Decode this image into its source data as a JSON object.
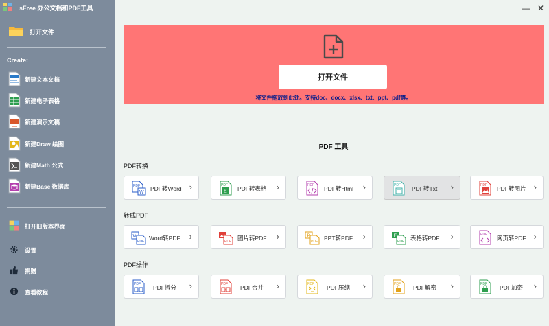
{
  "app": {
    "title": "sFree 办公文档和PDF工具"
  },
  "window": {
    "minimize": "—",
    "close": "✕"
  },
  "sidebar": {
    "open_file": "打开文件",
    "create_label": "Create:",
    "create_items": [
      {
        "label": "新建文本文档",
        "color": "#2a7ac8"
      },
      {
        "label": "新建电子表格",
        "color": "#2e9e4f"
      },
      {
        "label": "新建演示文稿",
        "color": "#d9572b"
      },
      {
        "label": "新建Draw 绘图",
        "color": "#e3b71a"
      },
      {
        "label": "新建Math 公式",
        "color": "#555555"
      },
      {
        "label": "新建Base 数据库",
        "color": "#b33fae"
      }
    ],
    "legacy": "打开旧版本界面",
    "settings": "设置",
    "donate": "捐赠",
    "tutorial": "查看教程"
  },
  "dropzone": {
    "button": "打开文件",
    "hint": "将文件拖放到此处。支持doc、docx、xlsx、txt、ppt、pdf等。",
    "color": "#ff7575"
  },
  "tools": {
    "title": "PDF 工具",
    "sections": [
      {
        "label": "PDF转换",
        "items": [
          {
            "label": "PDF转Word",
            "icon": "pdf-to-word-icon",
            "color": "#2a5cc8"
          },
          {
            "label": "PDF转表格",
            "icon": "pdf-to-excel-icon",
            "color": "#2e9e4f"
          },
          {
            "label": "PDF转Html",
            "icon": "pdf-to-html-icon",
            "color": "#b33fae"
          },
          {
            "label": "PDF转Txt",
            "icon": "pdf-to-txt-icon",
            "color": "#3fb0a8",
            "active": true
          },
          {
            "label": "PDF转图片",
            "icon": "pdf-to-image-icon",
            "color": "#e0403a"
          }
        ]
      },
      {
        "label": "转成PDF",
        "items": [
          {
            "label": "Word转PDF",
            "icon": "word-to-pdf-icon",
            "color": "#2a5cc8"
          },
          {
            "label": "图片转PDF",
            "icon": "image-to-pdf-icon",
            "color": "#e0403a"
          },
          {
            "label": "PPT转PDF",
            "icon": "ppt-to-pdf-icon",
            "color": "#e3a21a"
          },
          {
            "label": "表格转PDF",
            "icon": "excel-to-pdf-icon",
            "color": "#2e9e4f"
          },
          {
            "label": "网页转PDF",
            "icon": "html-to-pdf-icon",
            "color": "#b33fae"
          }
        ]
      },
      {
        "label": "PDF操作",
        "items": [
          {
            "label": "PDF拆分",
            "icon": "pdf-split-icon",
            "color": "#2a5cc8"
          },
          {
            "label": "PDF合并",
            "icon": "pdf-merge-icon",
            "color": "#e0403a"
          },
          {
            "label": "PDF压缩",
            "icon": "pdf-compress-icon",
            "color": "#e3b71a"
          },
          {
            "label": "PDF解密",
            "icon": "pdf-decrypt-icon",
            "color": "#e3a21a"
          },
          {
            "label": "PDF加密",
            "icon": "pdf-encrypt-icon",
            "color": "#2e9e4f"
          }
        ]
      }
    ]
  }
}
